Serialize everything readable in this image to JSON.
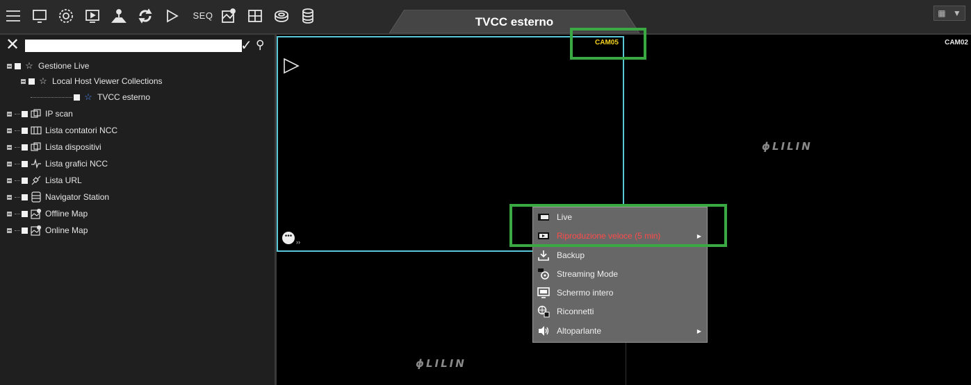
{
  "toolbar": {
    "seq_label": "SEQ",
    "active_tab": "TVCC esterno",
    "icons": [
      "menu-icon",
      "monitor-icon",
      "gear-icon",
      "playback-screen-icon",
      "map-pin-icon",
      "sync-icon",
      "play-icon",
      "seq",
      "map-icon",
      "layout-grid-icon",
      "database-disk-icon",
      "storage-icon"
    ]
  },
  "search": {
    "value": "",
    "placeholder": ""
  },
  "tree": [
    {
      "label": "Gestione Live",
      "icon": "star-icon"
    },
    {
      "label": "Local Host Viewer Collections",
      "icon": "star-icon"
    },
    {
      "label": "TVCC esterno",
      "icon": "star-blue-icon"
    },
    {
      "label": "IP scan",
      "icon": "device-icon"
    },
    {
      "label": "Lista contatori NCC",
      "icon": "counter-icon"
    },
    {
      "label": "Lista dispositivi",
      "icon": "device-icon"
    },
    {
      "label": "Lista grafici NCC",
      "icon": "graph-icon"
    },
    {
      "label": "Lista URL",
      "icon": "link-icon"
    },
    {
      "label": "Navigator Station",
      "icon": "server-icon"
    },
    {
      "label": "Offline Map",
      "icon": "map-icon"
    },
    {
      "label": "Online Map",
      "icon": "map-icon"
    }
  ],
  "cameras": {
    "cell1_label": "CAM05",
    "cell2_label": "CAM02",
    "logo_text": "LILIN",
    "logo_mark": "ϕ"
  },
  "context_menu": {
    "items": [
      {
        "label": "Live",
        "color": "#f0f0f0",
        "submenu": false
      },
      {
        "label": "Riproduzione veloce (5 min)",
        "color": "#ff4a4a",
        "submenu": true
      },
      {
        "label": "Backup",
        "color": "#f0f0f0",
        "submenu": false
      },
      {
        "label": "Streaming Mode",
        "color": "#f0f0f0",
        "submenu": false
      },
      {
        "label": "Schermo intero",
        "color": "#f0f0f0",
        "submenu": false
      },
      {
        "label": "Riconnetti",
        "color": "#f0f0f0",
        "submenu": false
      },
      {
        "label": "Altoparlante",
        "color": "#f0f0f0",
        "submenu": true
      }
    ]
  },
  "colors": {
    "highlight": "#3aa843",
    "selected_cell_border": "#58c9d6",
    "cam05_label": "#f2d21c",
    "cam02_label": "#e6e6e6"
  }
}
